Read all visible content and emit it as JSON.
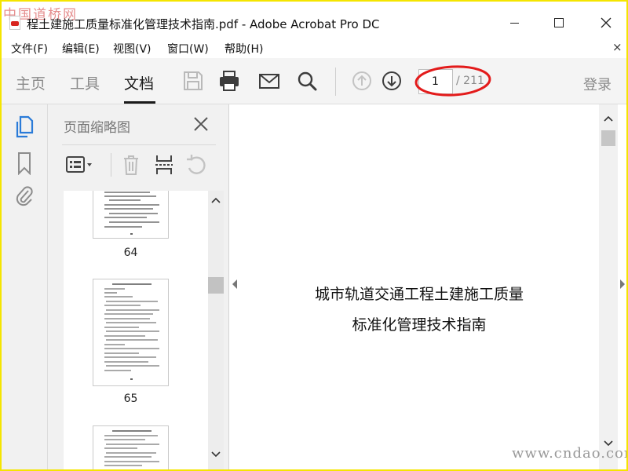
{
  "window": {
    "title": "程土建施工质量标准化管理技术指南.pdf - Adobe Acrobat Pro DC",
    "watermark": "中国道桥网"
  },
  "menubar": {
    "items": [
      "文件(F)",
      "编辑(E)",
      "视图(V)",
      "窗口(W)",
      "帮助(H)"
    ],
    "close_glyph": "×"
  },
  "toolbar": {
    "tabs": [
      "主页",
      "工具",
      "文档"
    ],
    "active_tab": "文档",
    "current_page": "1",
    "page_total": "/ 211",
    "login": "登录"
  },
  "sidebar": {
    "panel_title": "页面缩略图",
    "thumbnails": [
      {
        "label": "64"
      },
      {
        "label": "65"
      },
      {
        "label": ""
      }
    ]
  },
  "document": {
    "lines": [
      "城市轨道交通工程土建施工质量",
      "标准化管理技术指南"
    ]
  },
  "site_watermark": "www.cndao.com",
  "colors": {
    "frame": "#f5e500",
    "accent": "#2a7bd8",
    "annotation": "#e31b1b"
  },
  "icons": {
    "save": "floppy-disk",
    "print": "printer",
    "mail": "envelope",
    "search": "magnifier",
    "prev": "arrow-up-circle",
    "next": "arrow-down-circle"
  }
}
